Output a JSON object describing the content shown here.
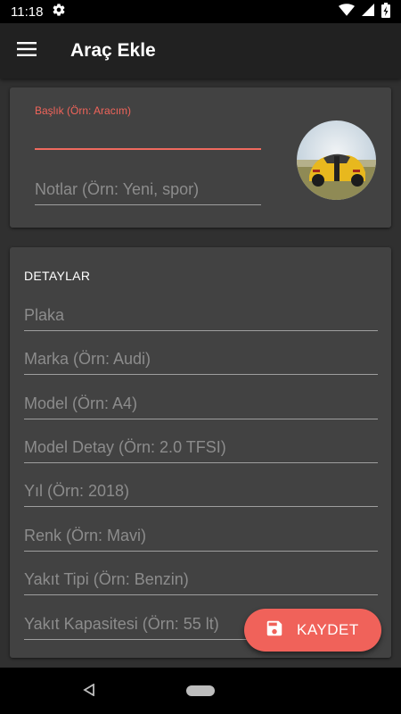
{
  "status_bar": {
    "time": "11:18"
  },
  "app_bar": {
    "title": "Araç Ekle"
  },
  "header_card": {
    "title_label": "Başlık (Örn: Aracım)",
    "title_value": "",
    "notes_placeholder": "Notlar (Örn: Yeni, spor)"
  },
  "details": {
    "section_title": "DETAYLAR",
    "fields": [
      {
        "placeholder": "Plaka"
      },
      {
        "placeholder": "Marka (Örn: Audi)"
      },
      {
        "placeholder": "Model (Örn: A4)"
      },
      {
        "placeholder": "Model Detay (Örn: 2.0 TFSI)"
      },
      {
        "placeholder": "Yıl (Örn: 2018)"
      },
      {
        "placeholder": "Renk (Örn: Mavi)"
      },
      {
        "placeholder": "Yakıt Tipi (Örn: Benzin)"
      },
      {
        "placeholder": "Yakıt Kapasitesi (Örn: 55 lt)"
      }
    ]
  },
  "fab": {
    "label": "KAYDET",
    "icon": "save-icon"
  },
  "colors": {
    "accent": "#f0625a",
    "app_bar": "#212121",
    "card": "#424242",
    "background": "#303030"
  }
}
